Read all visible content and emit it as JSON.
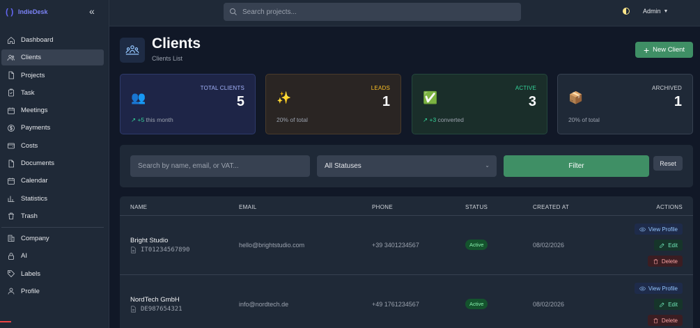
{
  "app": {
    "name": "IndieDesk"
  },
  "sidebar": {
    "items": [
      {
        "label": "Dashboard",
        "icon": "home-icon"
      },
      {
        "label": "Clients",
        "icon": "users-icon",
        "active": true
      },
      {
        "label": "Projects",
        "icon": "file-icon"
      },
      {
        "label": "Task",
        "icon": "clipboard-icon"
      },
      {
        "label": "Meetings",
        "icon": "calendar-icon"
      },
      {
        "label": "Payments",
        "icon": "dollar-icon"
      },
      {
        "label": "Costs",
        "icon": "wallet-icon"
      },
      {
        "label": "Documents",
        "icon": "document-icon"
      },
      {
        "label": "Calendar",
        "icon": "calendar-icon"
      },
      {
        "label": "Statistics",
        "icon": "bar-chart-icon"
      },
      {
        "label": "Trash",
        "icon": "trash-icon"
      },
      {
        "label": "Company",
        "icon": "building-icon"
      },
      {
        "label": "AI",
        "icon": "lock-icon"
      },
      {
        "label": "Labels",
        "icon": "tag-icon"
      },
      {
        "label": "Profile",
        "icon": "user-icon"
      }
    ]
  },
  "topbar": {
    "search_placeholder": "Search projects...",
    "user": "Admin"
  },
  "header": {
    "title": "Clients",
    "subtitle": "Clients List",
    "new_button": "New Client"
  },
  "stats": [
    {
      "label": "TOTAL CLIENTS",
      "value": "5",
      "emoji": "👥",
      "trend": "↗ +5",
      "foot": " this month"
    },
    {
      "label": "LEADS",
      "value": "1",
      "emoji": "✨",
      "trend": "",
      "foot": "20% of total"
    },
    {
      "label": "ACTIVE",
      "value": "3",
      "emoji": "✅",
      "trend": "↗ +3",
      "foot": " converted"
    },
    {
      "label": "ARCHIVED",
      "value": "1",
      "emoji": "📦",
      "trend": "",
      "foot": "20% of total"
    }
  ],
  "filters": {
    "search_placeholder": "Search by name, email, or VAT...",
    "status_selected": "All Statuses",
    "filter_button": "Filter",
    "reset_button": "Reset"
  },
  "table": {
    "headers": [
      "NAME",
      "EMAIL",
      "PHONE",
      "STATUS",
      "CREATED AT",
      "ACTIONS"
    ],
    "rows": [
      {
        "name": "Bright Studio",
        "vat": "IT01234567890",
        "email": "hello@brightstudio.com",
        "phone": "+39 3401234567",
        "status": "Active",
        "created": "08/02/2026"
      },
      {
        "name": "NordTech GmbH",
        "vat": "DE987654321",
        "email": "info@nordtech.de",
        "phone": "+49 1761234567",
        "status": "Active",
        "created": "08/02/2026"
      }
    ],
    "actions": {
      "view": "View Profile",
      "edit": "Edit",
      "delete": "Delete"
    }
  },
  "colors": {
    "accent": "#3f8f65",
    "brand": "#6366f1",
    "background": "#111827",
    "panel": "#1f2937"
  }
}
